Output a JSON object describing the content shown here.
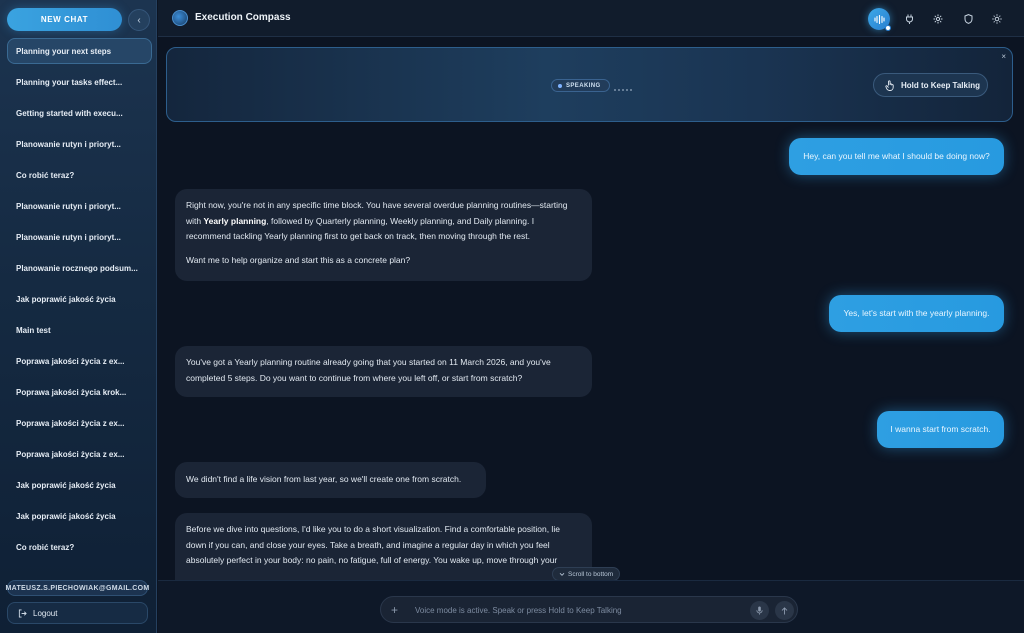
{
  "sidebar": {
    "new_chat_label": "NEW CHAT",
    "collapse_glyph": "‹",
    "chats": [
      "Planning your next steps",
      "Planning your tasks effect...",
      "Getting started with execu...",
      "Planowanie rutyn i prioryt...",
      "Co robić teraz?",
      "Planowanie rutyn i prioryt...",
      "Planowanie rutyn i prioryt...",
      "Planowanie rocznego podsum...",
      "Jak poprawić jakość życia",
      "Main test",
      "Poprawa jakości życia z ex...",
      "Poprawa jakości życia krok...",
      "Poprawa jakości życia z ex...",
      "Poprawa jakości życia z ex...",
      "Jak poprawić jakość życia",
      "Jak poprawić jakość życia",
      "Co robić teraz?"
    ],
    "active_index": 0,
    "email": "MATEUSZ.S.PIECHOWIAK@GMAIL.COM",
    "logout_label": "Logout"
  },
  "header": {
    "title": "Execution Compass",
    "icons": [
      "voice-mode-icon",
      "plug-icon",
      "settings-icon",
      "shield-icon",
      "sun-icon"
    ]
  },
  "voice_banner": {
    "status_label": "SPEAKING",
    "hold_button_label": "Hold to Keep Talking",
    "close_glyph": "×"
  },
  "messages": [
    {
      "role": "user",
      "text": "Hey, can you tell me what I should be doing now?"
    },
    {
      "role": "assistant",
      "paragraphs": [
        {
          "before": "Right now, you're not in any specific time block. You have several overdue planning routines—starting with ",
          "bold": "Yearly planning",
          "after": ", followed by Quarterly planning, Weekly planning, and Daily planning. I recommend tackling Yearly planning first to get back on track, then moving through the rest."
        },
        {
          "before": "Want me to help organize and start this as a concrete plan?",
          "bold": "",
          "after": ""
        }
      ]
    },
    {
      "role": "user",
      "text": "Yes, let's start with the yearly planning."
    },
    {
      "role": "assistant",
      "paragraphs": [
        {
          "before": "You've got a Yearly planning routine already going that you started on 11 March 2026, and you've completed 5 steps. Do you want to continue from where you left off, or start from scratch?",
          "bold": "",
          "after": ""
        }
      ]
    },
    {
      "role": "user",
      "text": "I wanna start from scratch."
    },
    {
      "role": "assistant",
      "paragraphs": [
        {
          "before": "We didn't find a life vision from last year, so we'll create one from scratch.",
          "bold": "",
          "after": ""
        }
      ]
    },
    {
      "role": "assistant",
      "paragraphs": [
        {
          "before": "Before we dive into questions, I'd like you to do a short visualization. Find a comfortable position, lie down if you can, and close your eyes. Take a breath, and imagine a regular day in which you feel absolutely perfect in your body: no pain, no fatigue, full of energy. You wake up, move through your",
          "bold": "",
          "after": ""
        }
      ]
    }
  ],
  "scroll_to_bottom_label": "Scroll to bottom",
  "composer": {
    "placeholder": "Voice mode is active. Speak or press Hold to Keep Talking"
  }
}
